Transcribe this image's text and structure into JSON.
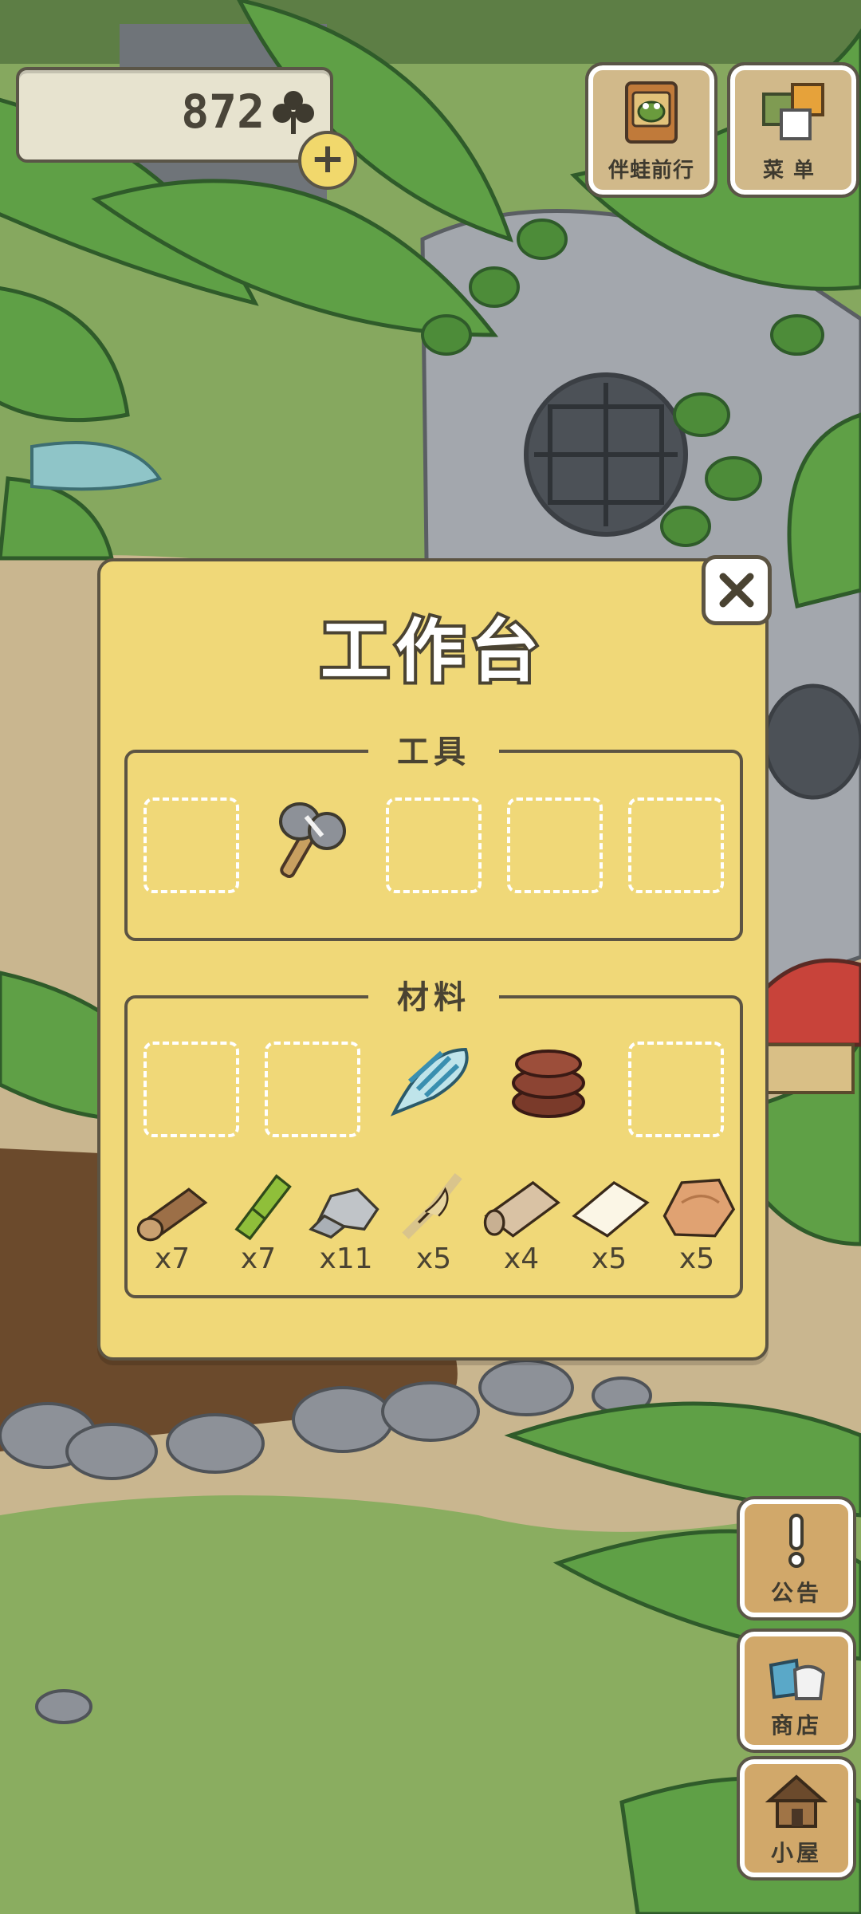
{
  "currency": {
    "amount": "872",
    "icon": "clover-icon",
    "add_icon": "plus-icon"
  },
  "top_buttons": {
    "companion": {
      "label": "伴蛙前行",
      "icon": "frog-card-icon"
    },
    "menu": {
      "label": "菜单",
      "icon": "menu-cards-icon"
    }
  },
  "side_buttons": {
    "notice": {
      "label": "公告",
      "icon": "exclamation-icon"
    },
    "shop": {
      "label": "商店",
      "icon": "shop-bags-icon"
    },
    "house": {
      "label": "小屋",
      "icon": "house-icon"
    }
  },
  "workbench": {
    "title": "工作台",
    "close_icon": "close-icon",
    "tools": {
      "label": "工具",
      "slots": [
        {
          "item": null
        },
        {
          "item": "stone-hammer"
        },
        {
          "item": null
        },
        {
          "item": null
        },
        {
          "item": null
        }
      ]
    },
    "materials": {
      "label": "材料",
      "slots": [
        {
          "item": null
        },
        {
          "item": null
        },
        {
          "item": "seashell"
        },
        {
          "item": "wood-slices"
        },
        {
          "item": null
        }
      ],
      "inventory": [
        {
          "item": "log",
          "count": "x7"
        },
        {
          "item": "bamboo",
          "count": "x7"
        },
        {
          "item": "stones",
          "count": "x11"
        },
        {
          "item": "straw",
          "count": "x5"
        },
        {
          "item": "cloth",
          "count": "x4"
        },
        {
          "item": "paper",
          "count": "x5"
        },
        {
          "item": "leather",
          "count": "x5"
        }
      ]
    }
  }
}
